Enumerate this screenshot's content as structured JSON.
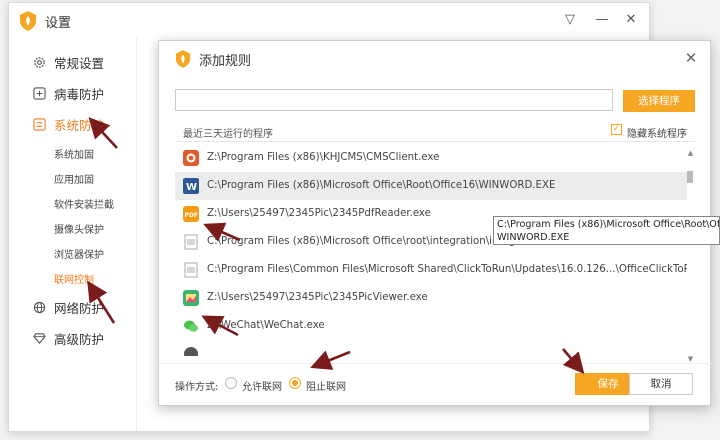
{
  "main_window": {
    "title": "设置",
    "controls": {
      "menu": "▽",
      "minimize": "—",
      "close": "✕"
    }
  },
  "sidebar": {
    "items": [
      {
        "label": "常规设置",
        "icon": "gear-icon",
        "active": false
      },
      {
        "label": "病毒防护",
        "icon": "plus-square-icon",
        "active": false
      },
      {
        "label": "系统防护",
        "icon": "system-icon",
        "active": true
      },
      {
        "label": "网络防护",
        "icon": "globe-icon",
        "active": false
      },
      {
        "label": "高级防护",
        "icon": "diamond-icon",
        "active": false
      }
    ],
    "subitems": [
      {
        "label": "系统加固",
        "active": false
      },
      {
        "label": "应用加固",
        "active": false
      },
      {
        "label": "软件安装拦截",
        "active": false
      },
      {
        "label": "摄像头保护",
        "active": false
      },
      {
        "label": "浏览器保护",
        "active": false
      },
      {
        "label": "联网控制",
        "active": true
      }
    ]
  },
  "dialog": {
    "title": "添加规则",
    "close": "✕",
    "path_input": {
      "value": "",
      "placeholder": ""
    },
    "select_button": "选择程序",
    "recent_label": "最近三天运行的程序",
    "hide_system": {
      "label": "隐藏系统程序",
      "checked": true
    },
    "programs": [
      {
        "path": "Z:\\Program Files (x86)\\KHJCMS\\CMSClient.exe",
        "icon": "camera-app-icon",
        "icon_color": "#e25b2a",
        "selected": false
      },
      {
        "path": "C:\\Program Files (x86)\\Microsoft Office\\Root\\Office16\\WINWORD.EXE",
        "icon": "word-icon",
        "icon_color": "#2b5797",
        "selected": true
      },
      {
        "path": "Z:\\Users\\25497\\2345Pic\\2345PdfReader.exe",
        "icon": "pdf-icon",
        "icon_color": "#f39c12",
        "selected": false
      },
      {
        "path": "C:\\Program Files (x86)\\Microsoft Office\\root\\integration\\integrator.exe",
        "icon": "file-icon",
        "icon_color": "#cccccc",
        "selected": false
      },
      {
        "path": "C:\\Program Files\\Common Files\\Microsoft Shared\\ClickToRun\\Updates\\16.0.126...\\OfficeClickToRun.exe",
        "icon": "file-icon",
        "icon_color": "#cccccc",
        "selected": false
      },
      {
        "path": "Z:\\Users\\25497\\2345Pic\\2345PicViewer.exe",
        "icon": "pic-viewer-icon",
        "icon_color": "#3cb371",
        "selected": false
      },
      {
        "path": "Z:\\WeChat\\WeChat.exe",
        "icon": "wechat-icon",
        "icon_color": "#4cbf4c",
        "selected": false
      }
    ],
    "operation_label": "操作方式:",
    "options": [
      {
        "label": "允许联网",
        "checked": false
      },
      {
        "label": "阻止联网",
        "checked": true
      }
    ],
    "save_button": "保存",
    "cancel_button": "取消"
  },
  "tooltip": {
    "line1": "C:\\Program Files (x86)\\Microsoft Office\\Root\\Offi",
    "line2": "WINWORD.EXE"
  },
  "colors": {
    "accent": "#f5a623",
    "active_text": "#f07b1e",
    "arrow": "#7a1c1c"
  }
}
